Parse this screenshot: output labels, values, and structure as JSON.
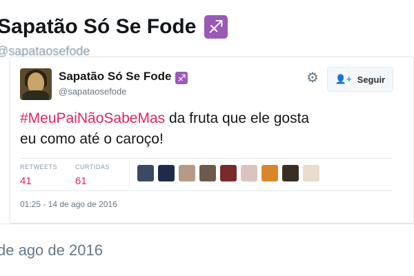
{
  "background": {
    "profile_name": "Sapatão Só Se Fode",
    "profile_handle": "@sapataosefode",
    "date_text": "de ago de 2016",
    "badge_icon": "sagittarius-emoji"
  },
  "tweet": {
    "author_name": "Sapatão Só Se Fode",
    "author_handle": "@sapataosefode",
    "badge_icon": "sagittarius-emoji",
    "follow_label": "Seguir",
    "hashtag": "#MeuPaiNãoSabeMas",
    "text_line1": " da fruta que ele gosta",
    "text_line2": "eu como até o caroço!",
    "stats": {
      "retweets_label": "RETWEETS",
      "retweets_value": "41",
      "likes_label": "CURTIDAS",
      "likes_value": "61"
    },
    "liker_avatar_count": 9,
    "timestamp": "01:25 - 14 de ago de 2016"
  },
  "colors": {
    "hashtag": "#e0245e",
    "stat_value": "#e0245e",
    "follow_icon": "#1da1f2",
    "badge": "#9b59b6"
  }
}
